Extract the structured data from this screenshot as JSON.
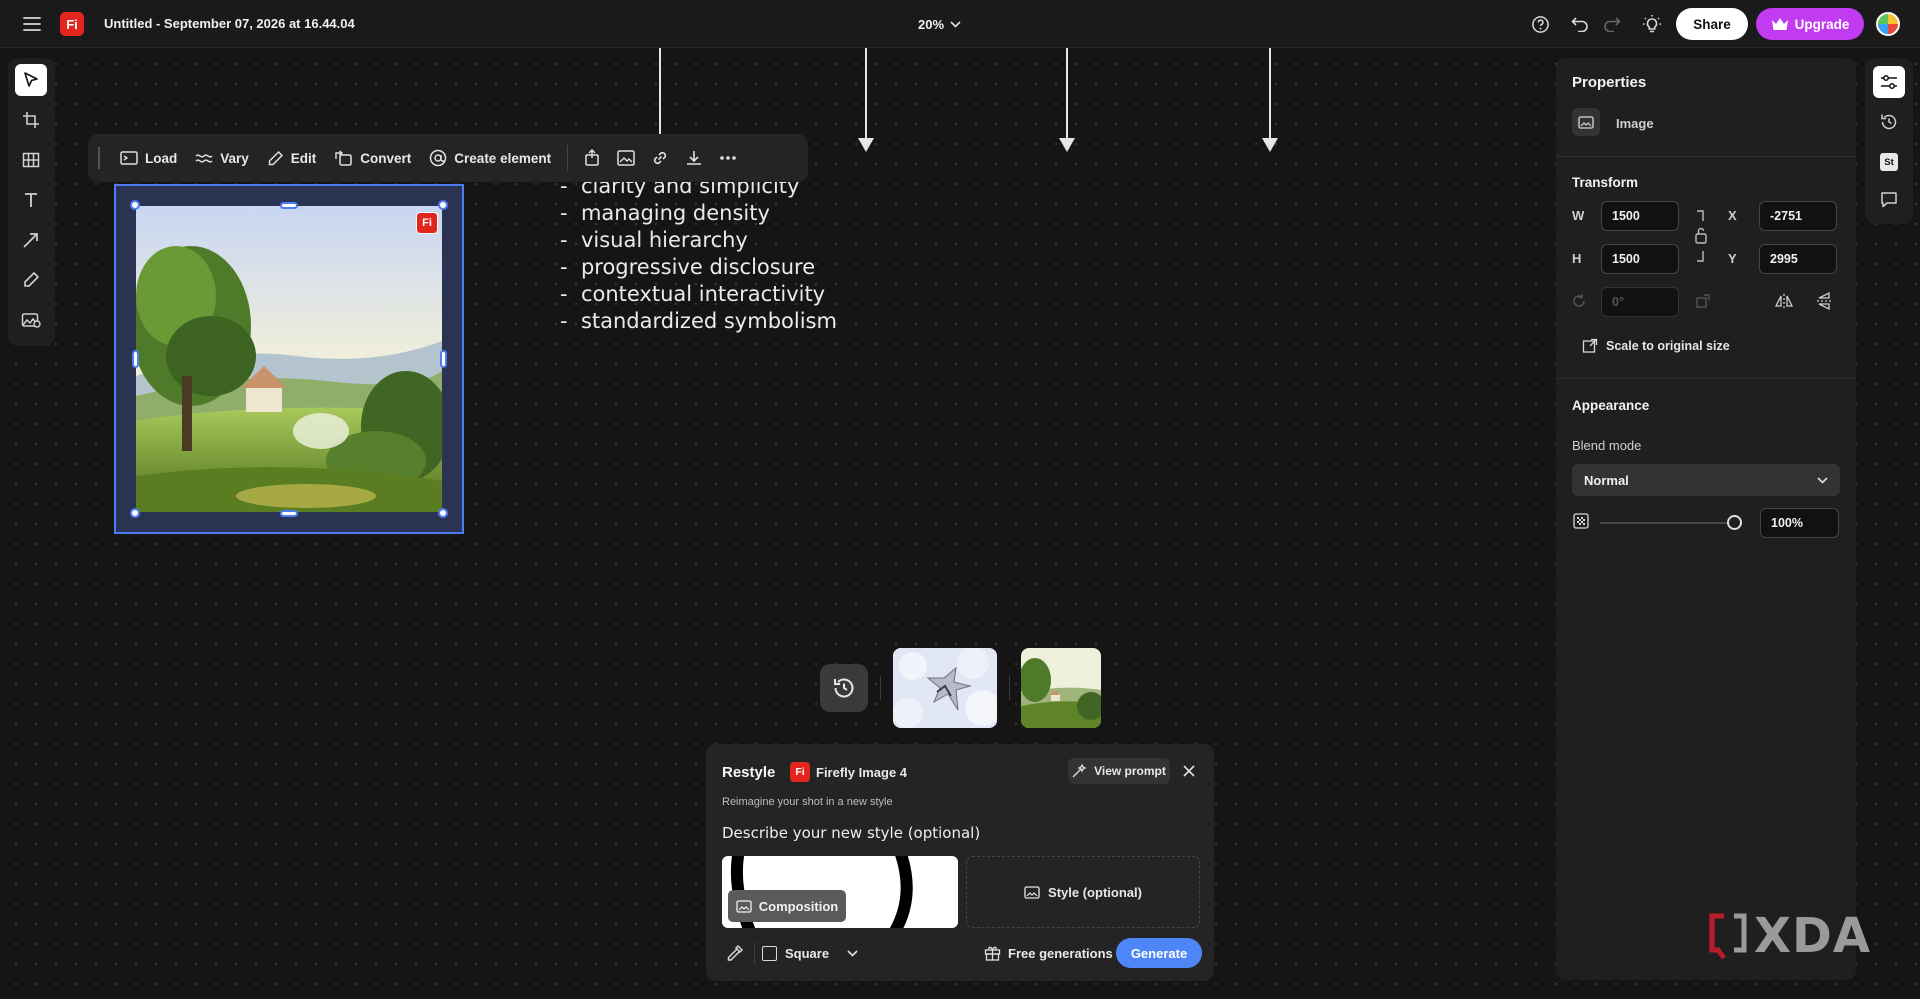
{
  "app": {
    "logo_text": "Fi",
    "document_title": "Untitled - September 07, 2026 at 16.44.04",
    "zoom": "20%",
    "share_label": "Share",
    "upgrade_label": "Upgrade"
  },
  "context_toolbar": {
    "load": "Load",
    "vary": "Vary",
    "edit": "Edit",
    "convert": "Convert",
    "create_element": "Create element"
  },
  "canvas": {
    "image_badge": "Fi",
    "bullets": [
      "clarity and simplicity",
      "managing density",
      "visual hierarchy",
      "progressive disclosure",
      "contextual interactivity",
      "standardized symbolism"
    ],
    "bullet_marker": "-"
  },
  "properties": {
    "title": "Properties",
    "object_type": "Image",
    "transform_title": "Transform",
    "w_label": "W",
    "w_value": "1500",
    "h_label": "H",
    "h_value": "1500",
    "x_label": "X",
    "x_value": "-2751",
    "y_label": "Y",
    "y_value": "2995",
    "rotation_placeholder": "0°",
    "scale_original": "Scale to original size",
    "appearance_title": "Appearance",
    "blend_mode_label": "Blend mode",
    "blend_mode_value": "Normal",
    "opacity_value": "100%"
  },
  "right_rail": {
    "stock_badge": "St"
  },
  "restyle": {
    "title": "Restyle",
    "model_badge": "Fi",
    "model_name": "Firefly Image 4",
    "view_prompt": "View prompt",
    "subtitle": "Reimagine your shot in a new style",
    "describe_label": "Describe your new style (optional)",
    "composition_label": "Composition",
    "style_label": "Style (optional)",
    "aspect_label": "Square",
    "free_generations": "Free generations",
    "generate": "Generate"
  },
  "watermark": {
    "text": "XDA"
  },
  "colors": {
    "accent_blue": "#4d7cf2",
    "upgrade_purple": "#c13cf0",
    "brand_red": "#e3261d",
    "generate_blue": "#4f86f7"
  }
}
